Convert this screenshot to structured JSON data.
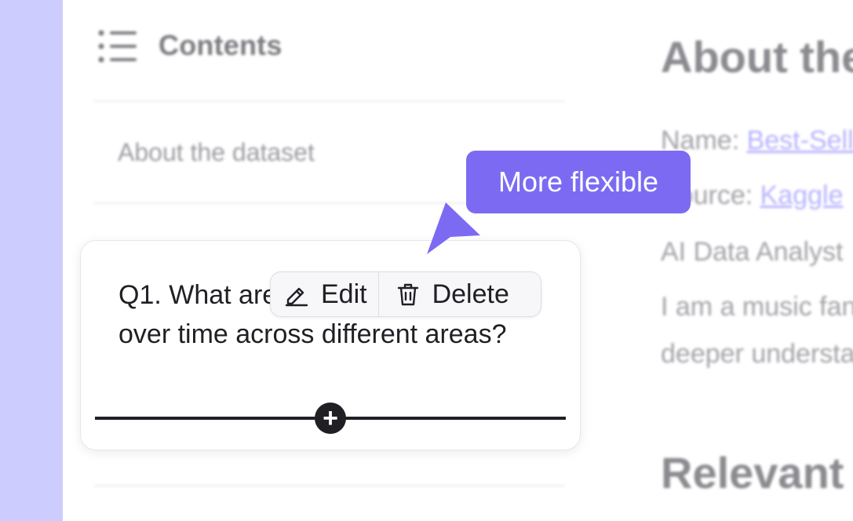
{
  "toc": {
    "title": "Contents",
    "items": [
      {
        "label": "About the dataset"
      }
    ]
  },
  "article": {
    "heading": "About the dataset",
    "meta": [
      {
        "label": "Name: ",
        "value": "Best-Selling Music Artists"
      },
      {
        "label": "Source: ",
        "value": "Kaggle"
      },
      {
        "label": "",
        "value": "AI Data Analyst"
      }
    ],
    "paragraph_lines": [
      "I am a music fan and want a",
      "deeper understanding of"
    ],
    "subheading": "Relevant questions"
  },
  "card": {
    "question": "Q1. What are the trends in sales over time across different areas?"
  },
  "toolbar": {
    "edit_label": "Edit",
    "delete_label": "Delete"
  },
  "insert_button_label": "+",
  "callout": {
    "text": "More flexible"
  },
  "colors": {
    "accent": "#7c6bf2",
    "side_strip": "#ccccff",
    "text_dark": "#1f1f24",
    "link": "#b7b2ff"
  },
  "icons": {
    "toc": "list-icon",
    "edit": "pencil-icon",
    "delete": "trash-icon",
    "insert": "plus-icon",
    "pointer": "cursor-arrow-icon"
  }
}
